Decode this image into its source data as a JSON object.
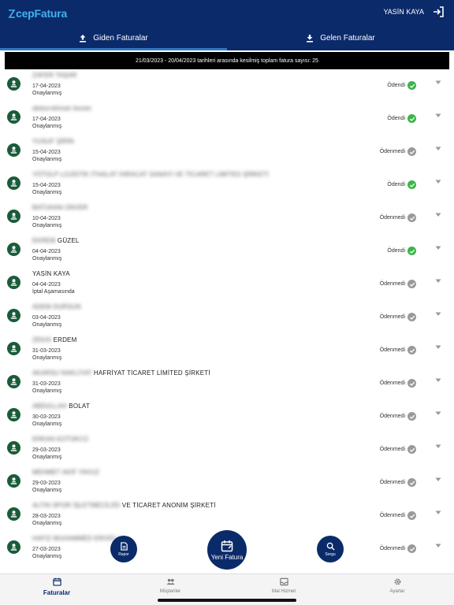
{
  "app": {
    "logo_text": "cepFatura"
  },
  "header": {
    "user_name": "YASİN KAYA"
  },
  "tabs": [
    {
      "label": "Giden Faturalar",
      "icon": "upload-icon",
      "active": true
    },
    {
      "label": "Gelen Faturalar",
      "icon": "download-icon",
      "active": false
    }
  ],
  "summary": "21/03/2023 - 20/04/2023 tarihleri arasında kesilmiş toplam fatura sayısı: 25",
  "invoices": [
    {
      "name_blur": "ZAFER TAŞAR",
      "name_clear": "",
      "date": "17-04-2023",
      "state": "Onaylanmış",
      "payment": "Ödendi",
      "paid": true
    },
    {
      "name_blur": "abdurrahman bozan",
      "name_clear": "",
      "date": "17-04-2023",
      "state": "Onaylanmış",
      "payment": "Ödendi",
      "paid": true
    },
    {
      "name_blur": "YUSUF ŞİRİN",
      "name_clear": "",
      "date": "15-04-2023",
      "state": "Onaylanmış",
      "payment": "Ödenmedi",
      "paid": false
    },
    {
      "name_blur": "YÖTÜLP LOJİSTİK İTHALAT İHRACAT SANAYİ VE TİCARET LİMİTED ŞİRKETİ",
      "name_clear": "",
      "date": "15-04-2023",
      "state": "Onaylanmış",
      "payment": "Ödendi",
      "paid": true
    },
    {
      "name_blur": "BATUHAN ÜNVER",
      "name_clear": "",
      "date": "10-04-2023",
      "state": "Onaylanmış",
      "payment": "Ödenmedi",
      "paid": false
    },
    {
      "name_blur": "EKREM",
      "name_clear": "GÜZEL",
      "date": "04-04-2023",
      "state": "Onaylanmış",
      "payment": "Ödendi",
      "paid": true
    },
    {
      "name_blur": "",
      "name_clear": "YASİN KAYA",
      "date": "04-04-2023",
      "state": "İptal Aşamasında",
      "payment": "Ödenmedi",
      "paid": false
    },
    {
      "name_blur": "ADEM DURSUN",
      "name_clear": "",
      "date": "03-04-2023",
      "state": "Onaylanmış",
      "payment": "Ödenmedi",
      "paid": false
    },
    {
      "name_blur": "ZEKAİ",
      "name_clear": "ERDEM",
      "date": "31-03-2023",
      "state": "Onaylanmış",
      "payment": "Ödenmedi",
      "paid": false
    },
    {
      "name_blur": "AKARSU NAKLİYAT",
      "name_clear": "HAFRİYAT TİCARET LİMİTED ŞİRKETİ",
      "date": "31-03-2023",
      "state": "Onaylanmış",
      "payment": "Ödenmedi",
      "paid": false
    },
    {
      "name_blur": "ABDULLAH",
      "name_clear": "BOLAT",
      "date": "30-03-2023",
      "state": "Onaylanmış",
      "payment": "Ödenmedi",
      "paid": false
    },
    {
      "name_blur": "ERKAN KÜTÜKCÜ",
      "name_clear": "",
      "date": "29-03-2023",
      "state": "Onaylanmış",
      "payment": "Ödenmedi",
      "paid": false
    },
    {
      "name_blur": "MEHMET AKİF YAVUZ",
      "name_clear": "",
      "date": "29-03-2023",
      "state": "Onaylanmış",
      "payment": "Ödenmedi",
      "paid": false
    },
    {
      "name_blur": "ALTIN SPOR İŞLETMECİLİĞİ",
      "name_clear": "VE TİCARET ANONİM ŞİRKETİ",
      "date": "28-03-2023",
      "state": "Onaylanmış",
      "payment": "Ödenmedi",
      "paid": false
    },
    {
      "name_blur": "HAFIZ MUHAMMED EROĞLU",
      "name_clear": "",
      "date": "27-03-2023",
      "state": "Onaylanmış",
      "payment": "Ödenmedi",
      "paid": false
    }
  ],
  "fabs": {
    "report": "Rapor",
    "new_invoice": "Yeni Fatura",
    "query": "Sorgu"
  },
  "bottom_nav": [
    {
      "label": "Faturalar",
      "icon": "calendar-icon",
      "active": true
    },
    {
      "label": "Müşteriler",
      "icon": "people-icon",
      "active": false
    },
    {
      "label": "Mal Hizmet",
      "icon": "inbox-icon",
      "active": false
    },
    {
      "label": "Ayarlar",
      "icon": "gear-icon",
      "active": false
    }
  ],
  "colors": {
    "primary": "#0b2a6a",
    "paid_green": "#3bb54a",
    "unpaid_gray": "#9a9a9a",
    "avatar_green": "#1a5c3a"
  }
}
